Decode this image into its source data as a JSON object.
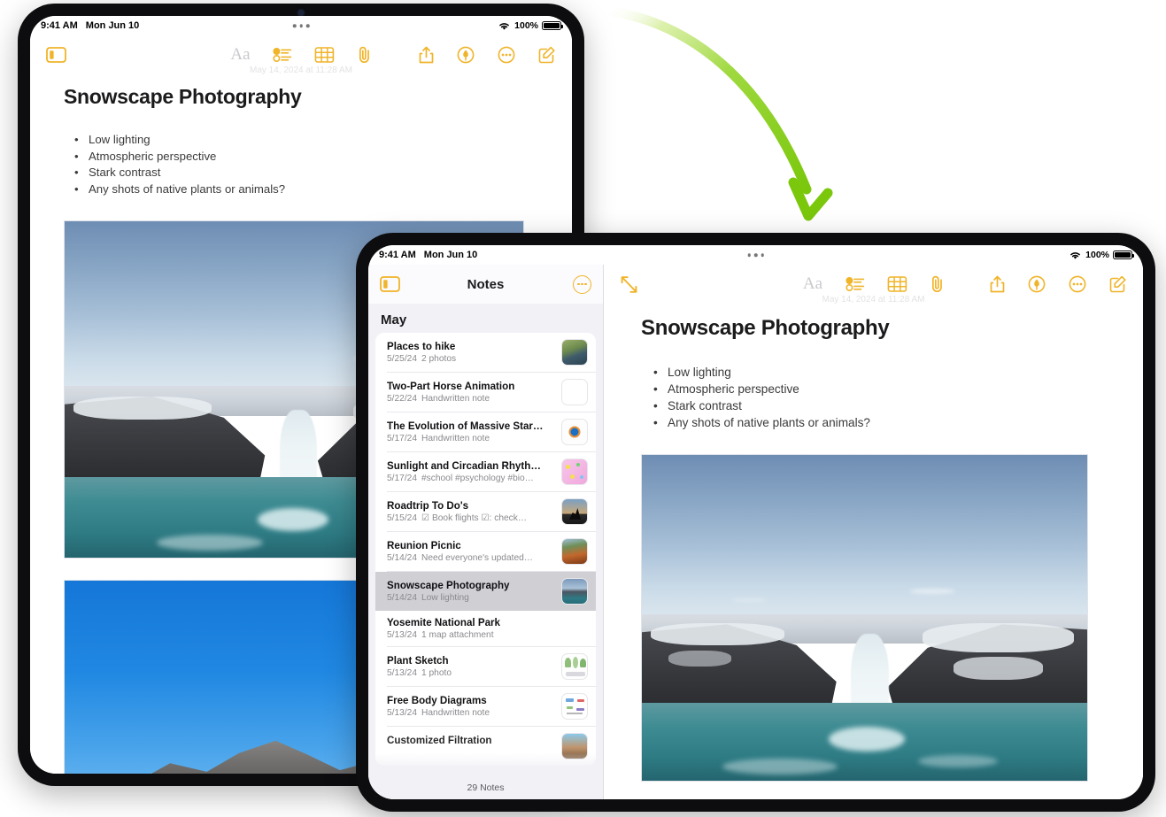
{
  "status_bar": {
    "time": "9:41 AM",
    "date": "Mon Jun 10",
    "battery_percent": "100%",
    "wifi_icon": "wifi-icon",
    "battery_icon": "battery-icon"
  },
  "toolbar": {
    "sidebar_toggle_icon": "sidebar-toggle-icon",
    "expand_icon": "expand-diagonal-arrows-icon",
    "format_label": "Aa",
    "checklist_icon": "checklist-icon",
    "table_icon": "table-icon",
    "attachment_icon": "paperclip-icon",
    "share_icon": "share-icon",
    "markup_icon": "markup-pen-icon",
    "more_icon": "more-ellipsis-icon",
    "compose_icon": "compose-new-note-icon",
    "edited_date": "May 14, 2024 at 11:28 AM"
  },
  "sidebar": {
    "title": "Notes",
    "toggle_icon": "sidebar-toggle-icon",
    "more_icon": "more-ellipsis-icon",
    "section_header": "May",
    "footer_count": "29 Notes",
    "notes": [
      {
        "title": "Places to hike",
        "date": "5/25/24",
        "preview": "2 photos",
        "thumb": "photo-landscape",
        "selected": false
      },
      {
        "title": "Two-Part Horse Animation",
        "date": "5/22/24",
        "preview": "Handwritten note",
        "thumb": "blank",
        "selected": false
      },
      {
        "title": "The Evolution of Massive Star…",
        "date": "5/17/24",
        "preview": "Handwritten note",
        "thumb": "diagram-circle",
        "selected": false
      },
      {
        "title": "Sunlight and Circadian Rhyth…",
        "date": "5/17/24",
        "preview": "#school #psychology #bio…",
        "thumb": "pink-sketch",
        "selected": false
      },
      {
        "title": "Roadtrip To Do's",
        "date": "5/15/24",
        "preview": "☑ Book flights ☑: check…",
        "thumb": "silhouette-photo",
        "selected": false
      },
      {
        "title": "Reunion Picnic",
        "date": "5/14/24",
        "preview": "Need everyone's updated…",
        "thumb": "picnic-photo",
        "selected": false
      },
      {
        "title": "Snowscape Photography",
        "date": "5/14/24",
        "preview": "Low lighting",
        "thumb": "snow-waterfall",
        "selected": true
      },
      {
        "title": "Yosemite National Park",
        "date": "5/13/24",
        "preview": "1 map attachment",
        "thumb": "none",
        "selected": false
      },
      {
        "title": "Plant Sketch",
        "date": "5/13/24",
        "preview": "1 photo",
        "thumb": "plant-sketch",
        "selected": false
      },
      {
        "title": "Free Body Diagrams",
        "date": "5/13/24",
        "preview": "Handwritten note",
        "thumb": "diagram-sketch",
        "selected": false
      },
      {
        "title": "Customized Filtration",
        "date": "",
        "preview": "",
        "thumb": "filtration-photo",
        "selected": false
      }
    ]
  },
  "note": {
    "title": "Snowscape Photography",
    "bullets": [
      "Low lighting",
      "Atmospheric perspective",
      "Stark contrast",
      "Any shots of native plants or animals?"
    ],
    "images": [
      {
        "name": "winter-waterfall-photo",
        "alt": "Frozen waterfall between basalt cliffs with snow"
      },
      {
        "name": "mountain-peaks-photo",
        "alt": "Rocky mountain peaks under clear blue sky"
      }
    ]
  },
  "annotation": {
    "arrow_name": "green-curved-arrow",
    "color_start": "#ffffff",
    "color_end": "#7ed321"
  },
  "colors": {
    "accent": "#F0B429",
    "sidebar_bg": "#f2f1f6",
    "selected_row": "#cfcfd4",
    "text_primary": "#1b1b1d",
    "text_secondary": "#8a8a8f"
  }
}
